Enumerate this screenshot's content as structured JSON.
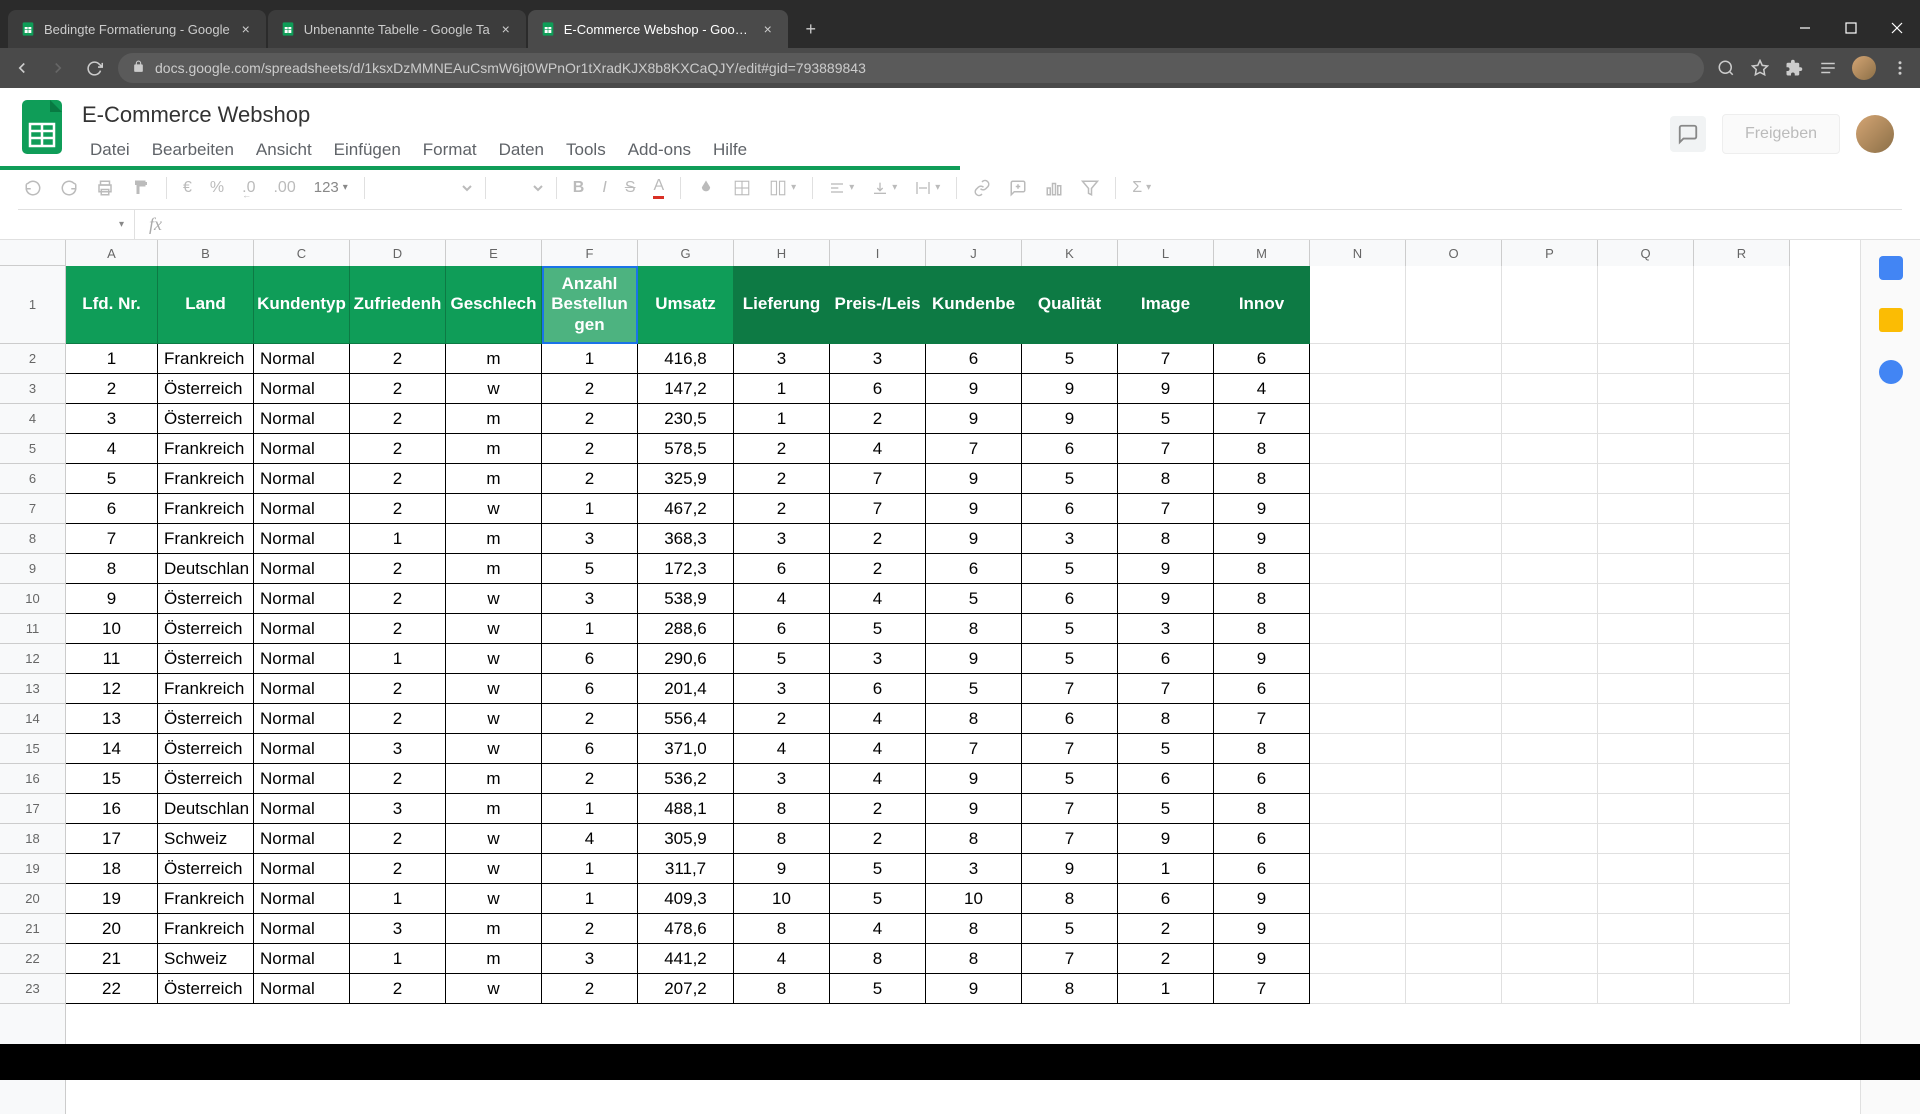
{
  "browser": {
    "tabs": [
      {
        "title": "Bedingte Formatierung - Google",
        "active": false
      },
      {
        "title": "Unbenannte Tabelle - Google Ta",
        "active": false
      },
      {
        "title": "E-Commerce Webshop - Google",
        "active": true
      }
    ],
    "url": "docs.google.com/spreadsheets/d/1ksxDzMMNEAuCsmW6jt0WPnOr1tXradKJX8b8KXCaQJY/edit#gid=793889843"
  },
  "doc": {
    "title": "E-Commerce Webshop",
    "menus": [
      "Datei",
      "Bearbeiten",
      "Ansicht",
      "Einfügen",
      "Format",
      "Daten",
      "Tools",
      "Add-ons",
      "Hilfe"
    ],
    "share_label": "Freigeben"
  },
  "toolbar": {
    "zoom": "123",
    "currency": "€",
    "percent": "%",
    "dec_dec": ".0",
    "inc_dec": ".00"
  },
  "columns": [
    "A",
    "B",
    "C",
    "D",
    "E",
    "F",
    "G",
    "H",
    "I",
    "J",
    "K",
    "L",
    "M",
    "N",
    "O",
    "P",
    "Q",
    "R"
  ],
  "headers": [
    "Lfd. Nr.",
    "Land",
    "Kundentyp",
    "Zufriedenh",
    "Geschlech",
    "Anzahl Bestellun gen",
    "Umsatz",
    "Lieferung",
    "Preis-/Leis",
    "Kundenbe",
    "Qualität",
    "Image",
    "Innov"
  ],
  "chart_data": {
    "type": "table",
    "rows": [
      [
        1,
        "Frankreich",
        "Normal",
        2,
        "m",
        1,
        "416,8",
        3,
        3,
        6,
        5,
        7,
        6
      ],
      [
        2,
        "Österreich",
        "Normal",
        2,
        "w",
        2,
        "147,2",
        1,
        6,
        9,
        9,
        9,
        4
      ],
      [
        3,
        "Österreich",
        "Normal",
        2,
        "m",
        2,
        "230,5",
        1,
        2,
        9,
        9,
        5,
        7
      ],
      [
        4,
        "Frankreich",
        "Normal",
        2,
        "m",
        2,
        "578,5",
        2,
        4,
        7,
        6,
        7,
        8
      ],
      [
        5,
        "Frankreich",
        "Normal",
        2,
        "m",
        2,
        "325,9",
        2,
        7,
        9,
        5,
        8,
        8
      ],
      [
        6,
        "Frankreich",
        "Normal",
        2,
        "w",
        1,
        "467,2",
        2,
        7,
        9,
        6,
        7,
        9
      ],
      [
        7,
        "Frankreich",
        "Normal",
        1,
        "m",
        3,
        "368,3",
        3,
        2,
        9,
        3,
        8,
        9
      ],
      [
        8,
        "Deutschlan",
        "Normal",
        2,
        "m",
        5,
        "172,3",
        6,
        2,
        6,
        5,
        9,
        8
      ],
      [
        9,
        "Österreich",
        "Normal",
        2,
        "w",
        3,
        "538,9",
        4,
        4,
        5,
        6,
        9,
        8
      ],
      [
        10,
        "Österreich",
        "Normal",
        2,
        "w",
        1,
        "288,6",
        6,
        5,
        8,
        5,
        3,
        8
      ],
      [
        11,
        "Österreich",
        "Normal",
        1,
        "w",
        6,
        "290,6",
        5,
        3,
        9,
        5,
        6,
        9
      ],
      [
        12,
        "Frankreich",
        "Normal",
        2,
        "w",
        6,
        "201,4",
        3,
        6,
        5,
        7,
        7,
        6
      ],
      [
        13,
        "Österreich",
        "Normal",
        2,
        "w",
        2,
        "556,4",
        2,
        4,
        8,
        6,
        8,
        7
      ],
      [
        14,
        "Österreich",
        "Normal",
        3,
        "w",
        6,
        "371,0",
        4,
        4,
        7,
        7,
        5,
        8
      ],
      [
        15,
        "Österreich",
        "Normal",
        2,
        "m",
        2,
        "536,2",
        3,
        4,
        9,
        5,
        6,
        6
      ],
      [
        16,
        "Deutschlan",
        "Normal",
        3,
        "m",
        1,
        "488,1",
        8,
        2,
        9,
        7,
        5,
        8
      ],
      [
        17,
        "Schweiz",
        "Normal",
        2,
        "w",
        4,
        "305,9",
        8,
        2,
        8,
        7,
        9,
        6
      ],
      [
        18,
        "Österreich",
        "Normal",
        2,
        "w",
        1,
        "311,7",
        9,
        5,
        3,
        9,
        1,
        6
      ],
      [
        19,
        "Frankreich",
        "Normal",
        1,
        "w",
        1,
        "409,3",
        10,
        5,
        10,
        8,
        6,
        9
      ],
      [
        20,
        "Frankreich",
        "Normal",
        3,
        "m",
        2,
        "478,6",
        8,
        4,
        8,
        5,
        2,
        9
      ],
      [
        21,
        "Schweiz",
        "Normal",
        1,
        "m",
        3,
        "441,2",
        4,
        8,
        8,
        7,
        2,
        9
      ],
      [
        22,
        "Österreich",
        "Normal",
        2,
        "w",
        2,
        "207,2",
        8,
        5,
        9,
        8,
        1,
        7
      ]
    ]
  }
}
